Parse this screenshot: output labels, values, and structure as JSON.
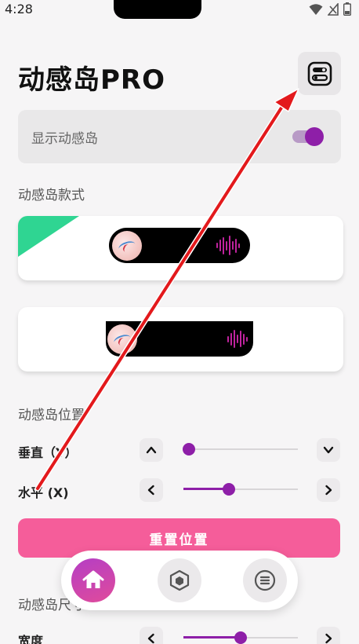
{
  "status_bar": {
    "time": "4:28",
    "icons": [
      "wifi-icon",
      "no-sim-icon",
      "battery-icon"
    ]
  },
  "app": {
    "title": "动感岛PRO",
    "settings_icon": "settings-toggles-icon"
  },
  "show_island": {
    "label": "显示动感岛",
    "enabled": true
  },
  "sections": {
    "style": "动感岛款式",
    "position": "动感岛位置",
    "size": "动感岛尺寸"
  },
  "styles": [
    {
      "name": "pill",
      "selected": true
    },
    {
      "name": "notch",
      "selected": false
    }
  ],
  "position": {
    "vertical": {
      "label": "垂直（Y）",
      "value": 0.02
    },
    "horizontal": {
      "label": "水平 (X)",
      "value": 0.4
    }
  },
  "size": {
    "width": {
      "label": "宽度",
      "value": 0.5
    }
  },
  "reset_button": "重置位置",
  "nav": [
    {
      "name": "home",
      "icon": "home-icon",
      "active": true
    },
    {
      "name": "style",
      "icon": "cube-icon",
      "active": false
    },
    {
      "name": "menu",
      "icon": "list-icon",
      "active": false
    }
  ],
  "colors": {
    "accent": "#8e1fa8",
    "reset": "#f55d9a",
    "selected_ribbon": "#2fd592",
    "annotation_arrow": "#e3191c"
  }
}
